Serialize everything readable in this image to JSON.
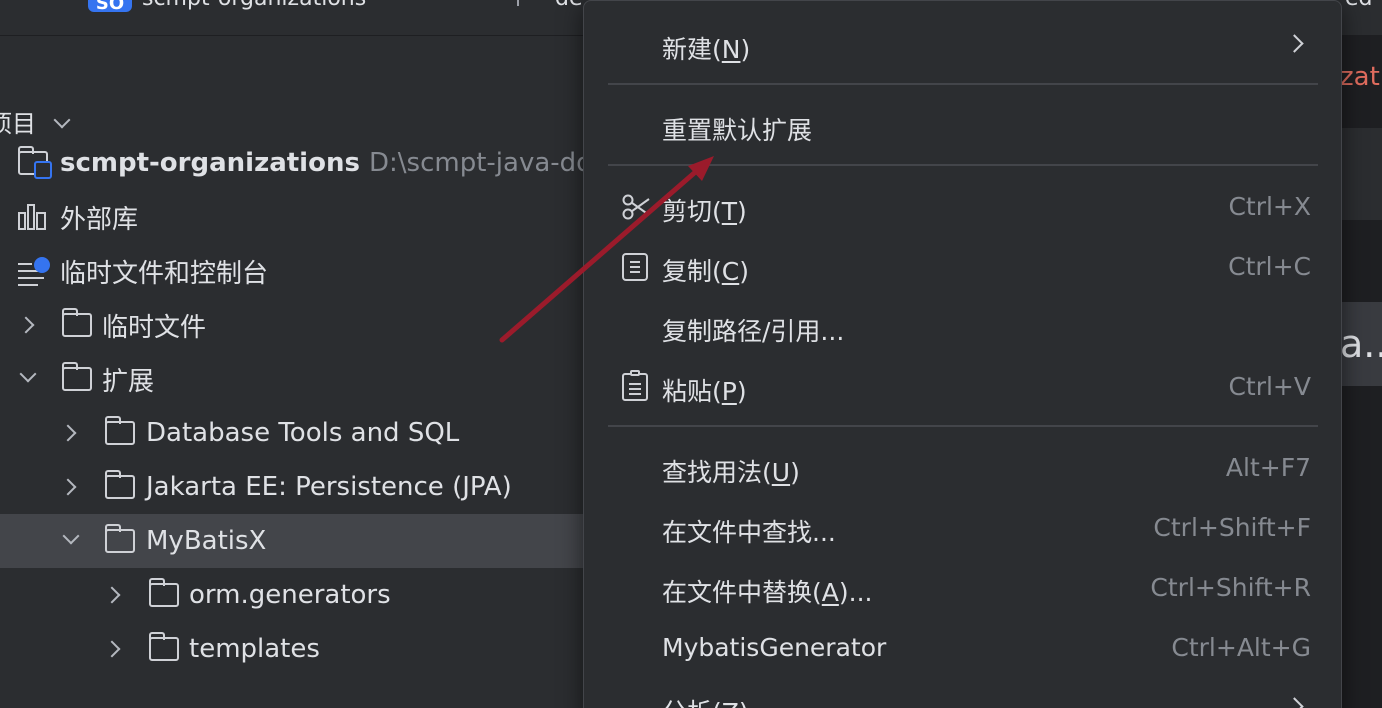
{
  "titlebar": {
    "project_badge": "SO",
    "project_name": "scmpt-organizations",
    "title_rest": "de",
    "title_right": "ed"
  },
  "panel": {
    "header": "项目",
    "items": [
      {
        "label": "scmpt-organizations",
        "path": "D:\\scmpt-java-dd"
      },
      {
        "label": "外部库"
      },
      {
        "label": "临时文件和控制台"
      },
      {
        "label": "临时文件"
      },
      {
        "label": "扩展"
      },
      {
        "label": "Database Tools and SQL"
      },
      {
        "label": "Jakarta EE: Persistence (JPA)"
      },
      {
        "label": "MyBatisX"
      },
      {
        "label": "orm.generators"
      },
      {
        "label": "templates"
      }
    ]
  },
  "editor": {
    "tab_text": "zat",
    "box_text": "a.."
  },
  "menu": {
    "new": {
      "label": "新建(",
      "mnemonic": "N",
      "suffix": ")"
    },
    "reset": {
      "label": "重置默认扩展"
    },
    "cut": {
      "label": "剪切(",
      "mnemonic": "T",
      "suffix": ")",
      "shortcut": "Ctrl+X"
    },
    "copy": {
      "label": "复制(",
      "mnemonic": "C",
      "suffix": ")",
      "shortcut": "Ctrl+C"
    },
    "copy_path": {
      "label": "复制路径/引用..."
    },
    "paste": {
      "label": "粘贴(",
      "mnemonic": "P",
      "suffix": ")",
      "shortcut": "Ctrl+V"
    },
    "find_usages": {
      "label": "查找用法(",
      "mnemonic": "U",
      "suffix": ")",
      "shortcut": "Alt+F7"
    },
    "find_in_files": {
      "label": "在文件中查找...",
      "shortcut": "Ctrl+Shift+F"
    },
    "replace_in_files": {
      "label": "在文件中替换(",
      "mnemonic": "A",
      "suffix": ")...",
      "shortcut": "Ctrl+Shift+R"
    },
    "mybatis_generator": {
      "label": "MybatisGenerator",
      "shortcut": "Ctrl+Alt+G"
    },
    "analyze": {
      "label": "分析(",
      "mnemonic": "Z",
      "suffix": ")"
    }
  },
  "colors": {
    "accent": "#3574f0",
    "annotation_arrow": "#9b1b2b"
  }
}
